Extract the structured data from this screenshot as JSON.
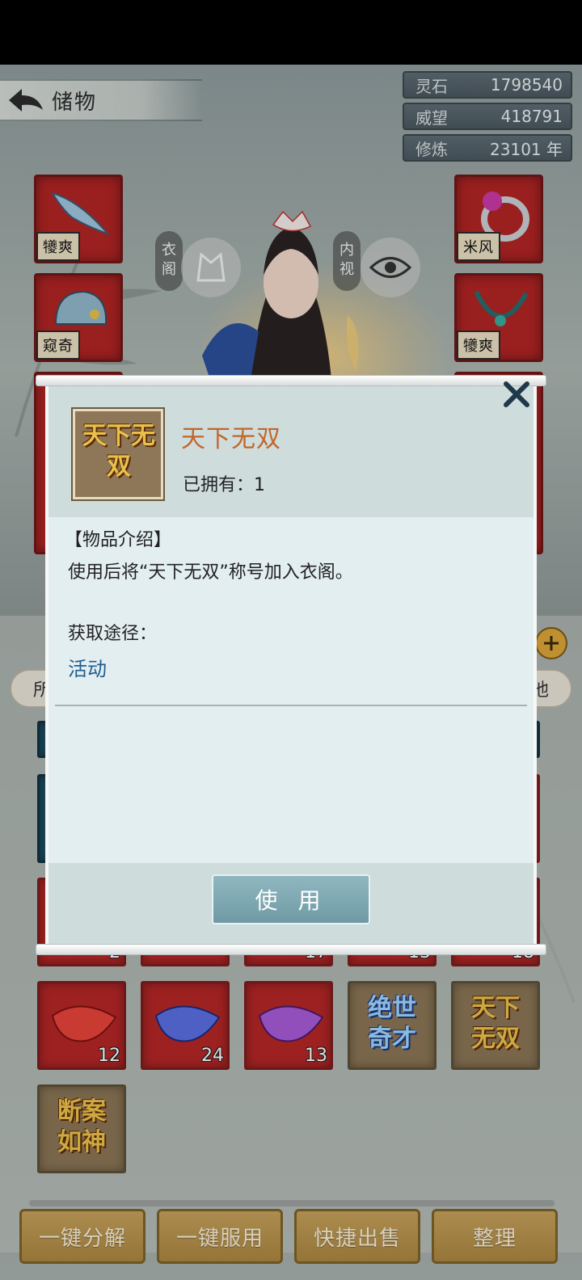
{
  "header": {
    "back_title": "储物",
    "resources": [
      {
        "label": "灵石",
        "value": "1798540"
      },
      {
        "label": "威望",
        "value": "418791"
      },
      {
        "label": "修炼",
        "value": "23101 年"
      }
    ]
  },
  "equipment": {
    "left_seals": [
      "犪爽",
      "窥奇"
    ],
    "right_seals": [
      "米风",
      "犪爽"
    ],
    "wardrobe_label": "衣阁",
    "inner_view_label": "内视"
  },
  "bag": {
    "filter_first": "所",
    "filter_last": "他",
    "row_counts_partial": [
      "2",
      "",
      "17",
      "13",
      "18"
    ],
    "row_petals": [
      {
        "color": "red",
        "count": "12"
      },
      {
        "color": "blue",
        "count": "24"
      },
      {
        "color": "purple",
        "count": "13"
      }
    ],
    "title_items": [
      {
        "text": "绝世奇才",
        "style": "blue"
      },
      {
        "text": "天下无双",
        "style": "gold"
      },
      {
        "text": "断案如神",
        "style": "gold"
      }
    ]
  },
  "actions": [
    "一键分解",
    "一键服用",
    "快捷出售",
    "整理"
  ],
  "dialog": {
    "item_art": "天下无双",
    "item_name": "天下无双",
    "owned": "已拥有：1",
    "section_title": "【物品介绍】",
    "description": "使用后将“天下无双”称号加入衣阁。",
    "source_title": "获取途径：",
    "source_link": "活动",
    "use_label": "使 用"
  },
  "colors": {
    "accent_name": "#c0672c",
    "link": "#1f5d8f",
    "slot_red": "#b32626",
    "button_gold": "#c4a05a"
  }
}
